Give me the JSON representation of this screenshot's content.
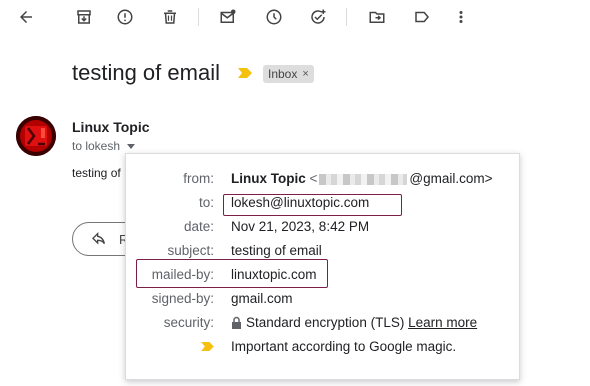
{
  "toolbar": {
    "icons": [
      "back-arrow-icon",
      "archive-icon",
      "report-spam-icon",
      "delete-icon",
      "mark-unread-icon",
      "snooze-icon",
      "add-to-tasks-icon",
      "move-to-icon",
      "labels-icon",
      "more-vert-icon"
    ]
  },
  "email": {
    "subject": "testing of email",
    "label": "Inbox",
    "label_close": "×",
    "sender_name": "Linux Topic",
    "to_line": "to lokesh",
    "snippet": "testing of",
    "reply_label": "R"
  },
  "details": {
    "from_label": "from:",
    "from_name": "Linux Topic",
    "from_prefix": "<",
    "from_suffix": "@gmail.com>",
    "to_label": "to:",
    "to_value": "lokesh@linuxtopic.com",
    "date_label": "date:",
    "date_value": "Nov 21, 2023, 8:42 PM",
    "subject_label": "subject:",
    "subject_value": "testing of email",
    "mailed_by_label": "mailed-by:",
    "mailed_by_value": "linuxtopic.com",
    "signed_by_label": "signed-by:",
    "signed_by_value": "gmail.com",
    "security_label": "security:",
    "security_value": "Standard encryption (TLS)",
    "security_link": "Learn more",
    "importance_value": "Important according to Google magic."
  },
  "colors": {
    "importance_marker": "#f5c10e",
    "highlight_box": "#7b1f4a"
  }
}
